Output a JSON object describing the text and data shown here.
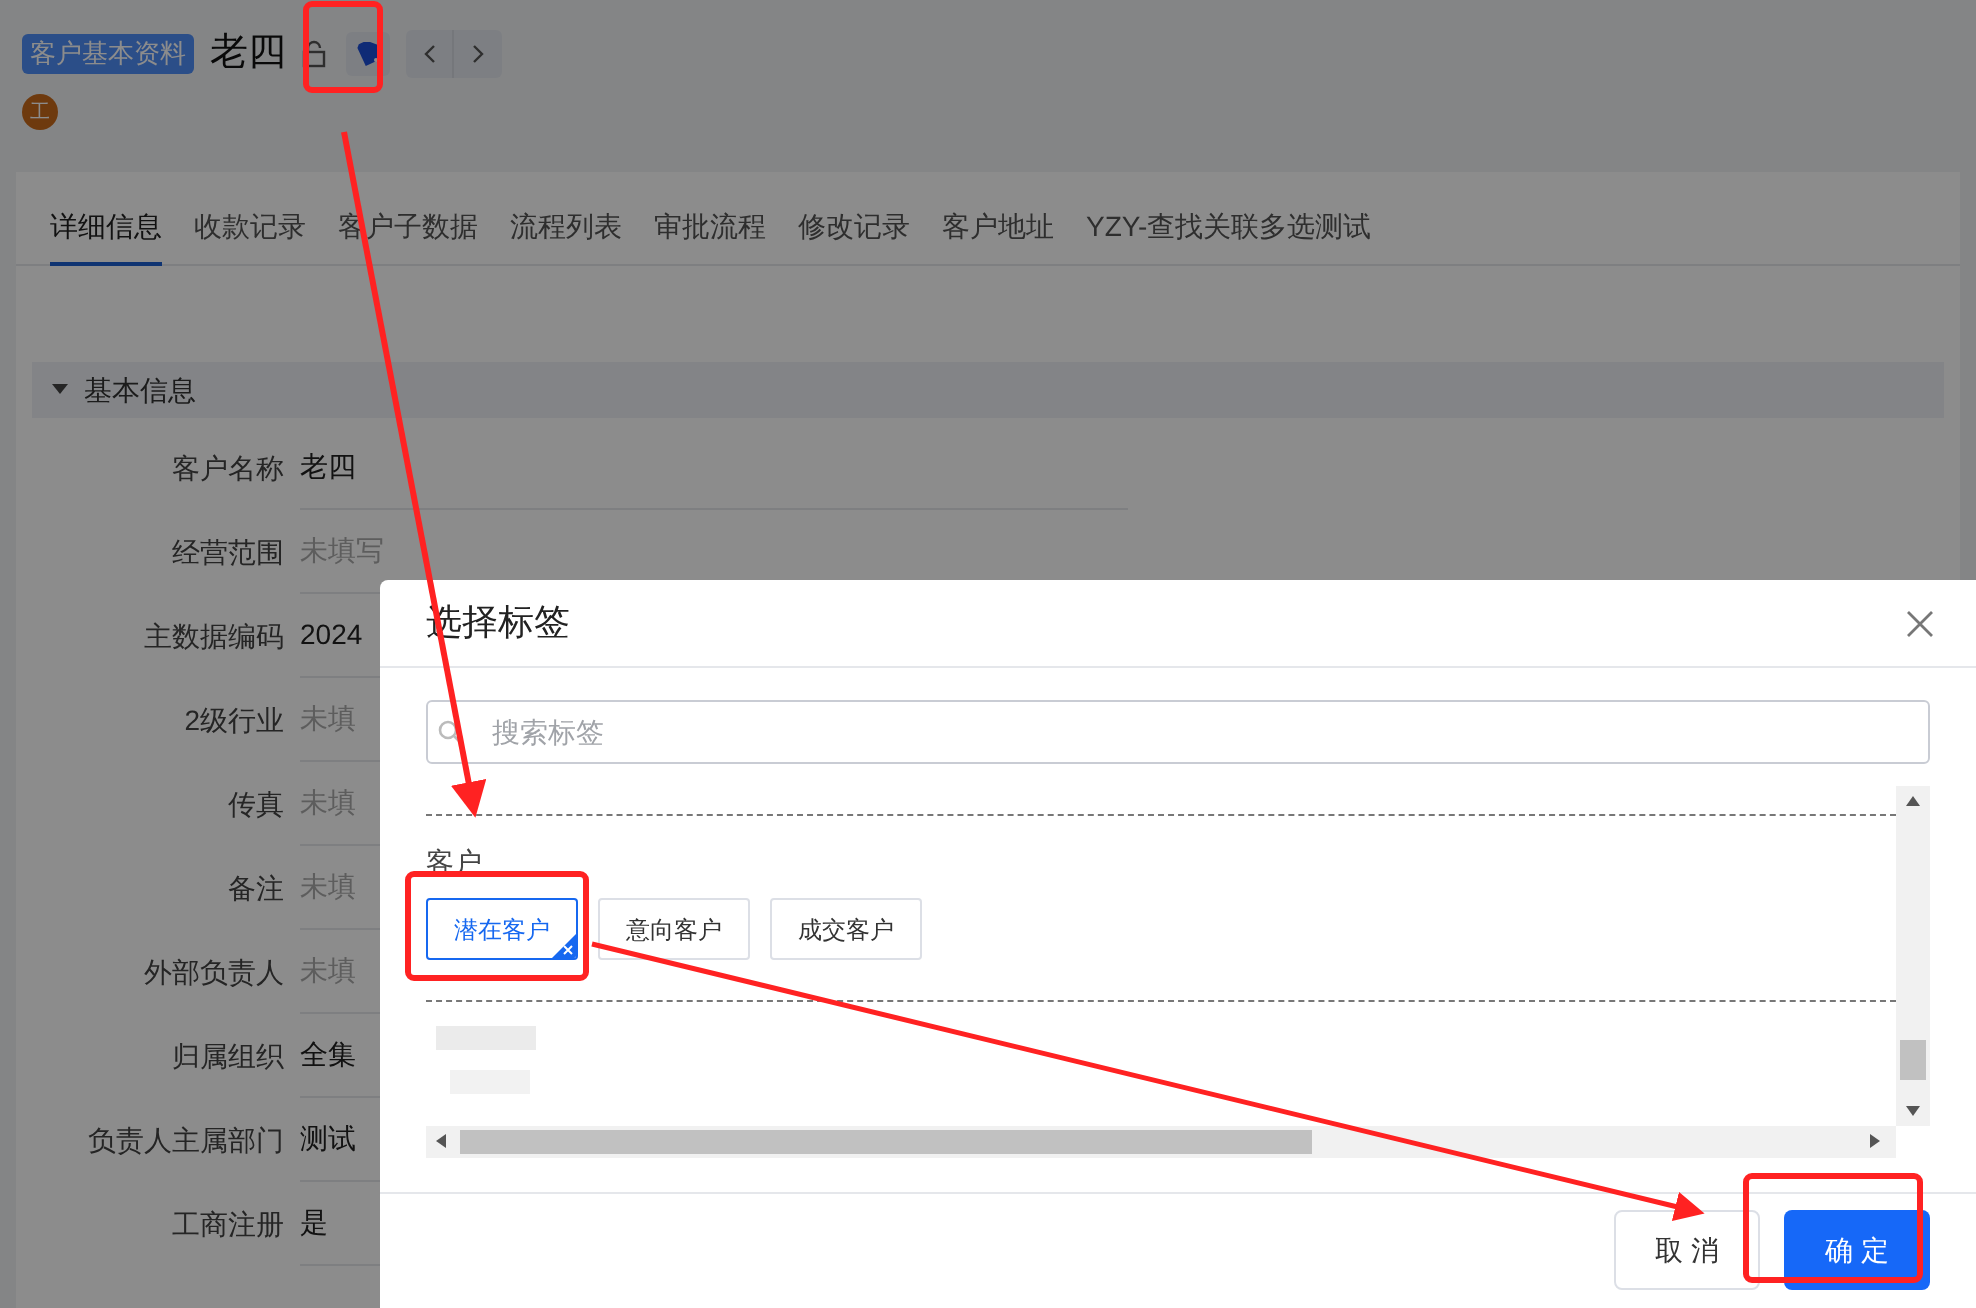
{
  "header": {
    "badge": "客户基本资料",
    "title": "老四",
    "avatar": "工"
  },
  "tabs": [
    {
      "label": "详细信息",
      "selected": true
    },
    {
      "label": "收款记录",
      "selected": false
    },
    {
      "label": "客户子数据",
      "selected": false
    },
    {
      "label": "流程列表",
      "selected": false
    },
    {
      "label": "审批流程",
      "selected": false
    },
    {
      "label": "修改记录",
      "selected": false
    },
    {
      "label": "客户地址",
      "selected": false
    },
    {
      "label": "YZY-查找关联多选测试",
      "selected": false
    }
  ],
  "section": {
    "title": "基本信息",
    "expanded": true
  },
  "fields": [
    {
      "label": "客户名称",
      "value": "老四",
      "empty": false
    },
    {
      "label": "经营范围",
      "value": "未填写",
      "empty": true
    },
    {
      "label": "主数据编码",
      "value": "2024",
      "empty": false
    },
    {
      "label": "2级行业",
      "value": "未填",
      "empty": true
    },
    {
      "label": "传真",
      "value": "未填",
      "empty": true
    },
    {
      "label": "备注",
      "value": "未填",
      "empty": true
    },
    {
      "label": "外部负责人",
      "value": "未填",
      "empty": true
    },
    {
      "label": "归属组织",
      "value": "全集",
      "empty": false
    },
    {
      "label": "负责人主属部门",
      "value": "测试",
      "empty": false
    },
    {
      "label": "工商注册",
      "value": "是",
      "empty": false
    }
  ],
  "dialog": {
    "title": "选择标签",
    "search": {
      "placeholder": "搜索标签"
    },
    "groups": [
      {
        "name": "客户",
        "tags": [
          {
            "label": "潜在客户",
            "selected": true
          },
          {
            "label": "意向客户",
            "selected": false
          },
          {
            "label": "成交客户",
            "selected": false
          }
        ]
      }
    ],
    "buttons": [
      {
        "label": "取 消",
        "kind": "secondary"
      },
      {
        "label": "确 定",
        "kind": "primary"
      }
    ]
  }
}
